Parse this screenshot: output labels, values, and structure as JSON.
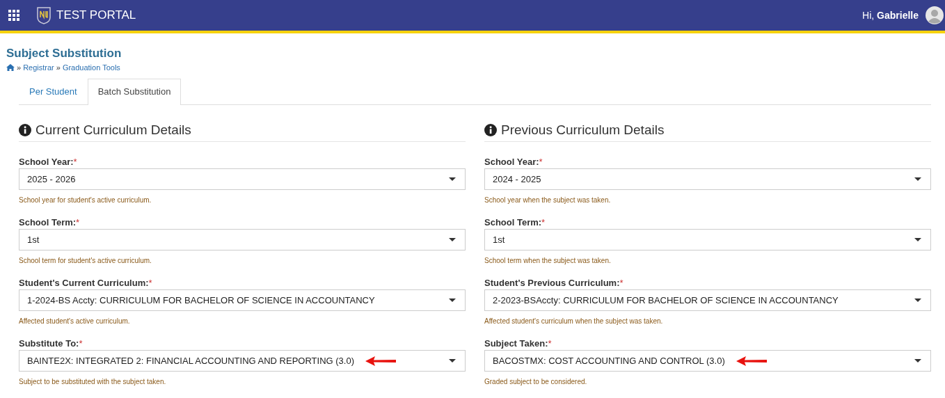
{
  "header": {
    "title": "TEST PORTAL",
    "greeting": "Hi,",
    "user": "Gabrielle"
  },
  "page": {
    "title": "Subject Substitution",
    "breadcrumb": [
      {
        "separator": "»",
        "label": "Registrar"
      },
      {
        "separator": "»",
        "label": "Graduation Tools"
      }
    ]
  },
  "tabs": [
    {
      "label": "Per Student",
      "selected": false
    },
    {
      "label": "Batch Substitution",
      "selected": true
    }
  ],
  "sections": [
    {
      "heading": "Current Curriculum Details",
      "fields": [
        {
          "label": "School Year:",
          "required_mark": "*",
          "value": "2025 - 2026",
          "help": "School year for student's active curriculum.",
          "arrow": false
        },
        {
          "label": "School Term:",
          "required_mark": "*",
          "value": "1st",
          "help": "School term for student's active curriculum.",
          "arrow": false
        },
        {
          "label": "Student's Current Curriculum:",
          "required_mark": "*",
          "value": "1-2024-BS Accty: CURRICULUM FOR BACHELOR OF SCIENCE IN ACCOUNTANCY",
          "help": "Affected student's active curriculum.",
          "arrow": false
        },
        {
          "label": "Substitute To:",
          "required_mark": "*",
          "value": "BAINTE2X: INTEGRATED 2: FINANCIAL ACCOUNTING AND REPORTING (3.0)",
          "help": "Subject to be substituted with the subject taken.",
          "arrow": true
        }
      ]
    },
    {
      "heading": "Previous Curriculum Details",
      "fields": [
        {
          "label": "School Year:",
          "required_mark": "*",
          "value": "2024 - 2025",
          "help": "School year when the subject was taken.",
          "arrow": false
        },
        {
          "label": "School Term:",
          "required_mark": "*",
          "value": "1st",
          "help": "School term when the subject was taken.",
          "arrow": false
        },
        {
          "label": "Student's Previous Curriculum:",
          "required_mark": "*",
          "value": "2-2023-BSAccty: CURRICULUM FOR BACHELOR OF SCIENCE IN ACCOUNTANCY",
          "help": "Affected student's curriculum when the subject was taken.",
          "arrow": false
        },
        {
          "label": "Subject Taken:",
          "required_mark": "*",
          "value": "BACOSTMX: COST ACCOUNTING AND CONTROL (3.0)",
          "help": "Graded subject to be considered.",
          "arrow": true
        }
      ]
    }
  ]
}
